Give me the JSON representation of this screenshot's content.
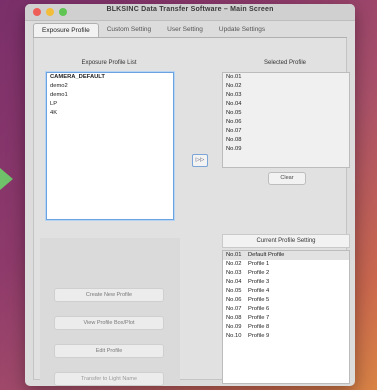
{
  "window": {
    "title": "BLKSINC Data Transfer Software – Main Screen"
  },
  "tabs": [
    {
      "label": "Exposure Profile",
      "active": true
    },
    {
      "label": "Custom Setting",
      "active": false
    },
    {
      "label": "User Setting",
      "active": false
    },
    {
      "label": "Update Settings",
      "active": false
    }
  ],
  "exposure_list": {
    "label": "Exposure Profile List",
    "items": [
      {
        "name": "CAMERA_DEFAULT",
        "bold": true
      },
      {
        "name": "demo2",
        "bold": false
      },
      {
        "name": "demo1",
        "bold": false
      },
      {
        "name": "LP",
        "bold": false
      },
      {
        "name": "4K",
        "bold": false
      }
    ]
  },
  "transfer_button": {
    "label": "▷▷"
  },
  "selected_profile": {
    "label": "Selected Profile",
    "slots": [
      "No.01",
      "No.02",
      "No.03",
      "No.04",
      "No.05",
      "No.06",
      "No.07",
      "No.08",
      "No.09"
    ],
    "clear_label": "Clear"
  },
  "current_setting": {
    "label": "Current Profile Setting",
    "rows": [
      {
        "num": "No.01",
        "name": "Default Profile"
      },
      {
        "num": "No.02",
        "name": "Profile 1"
      },
      {
        "num": "No.03",
        "name": "Profile 2"
      },
      {
        "num": "No.04",
        "name": "Profile 3"
      },
      {
        "num": "No.05",
        "name": "Profile 4"
      },
      {
        "num": "No.06",
        "name": "Profile 5"
      },
      {
        "num": "No.07",
        "name": "Profile 6"
      },
      {
        "num": "No.08",
        "name": "Profile 7"
      },
      {
        "num": "No.09",
        "name": "Profile 8"
      },
      {
        "num": "No.10",
        "name": "Profile 9"
      }
    ]
  },
  "actions": {
    "create_new": "Create New Profile",
    "view_profile": "View Profile Box/Plot",
    "edit_profile": "Edit Profile",
    "transfer_to_light": "Transfer to Light Name"
  }
}
